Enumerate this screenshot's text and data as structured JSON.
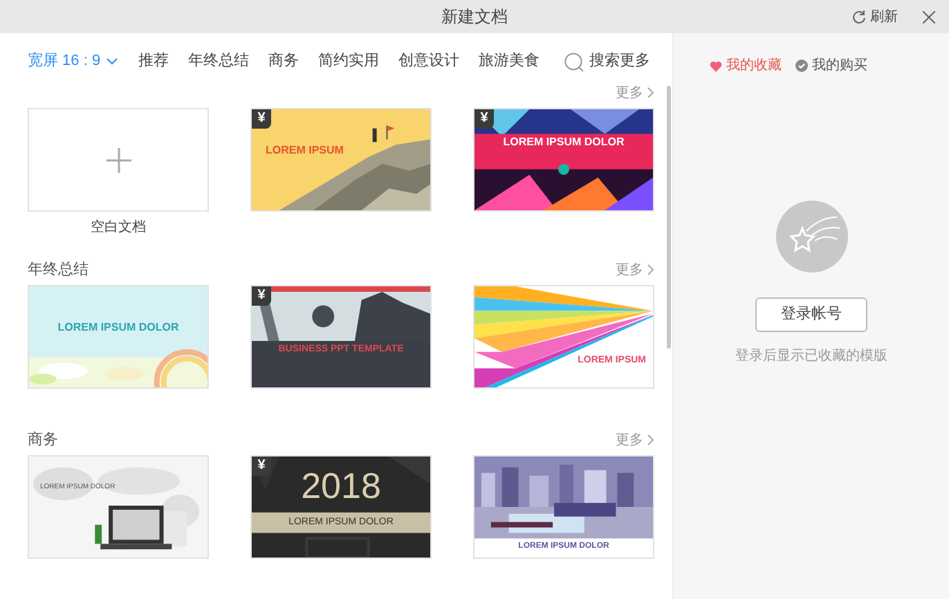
{
  "window": {
    "title": "新建文档",
    "refresh": "刷新"
  },
  "nav": {
    "ratio": "宽屏 16 : 9",
    "categories": [
      {
        "label": "推荐"
      },
      {
        "label": "年终总结"
      },
      {
        "label": "商务"
      },
      {
        "label": "简约实用"
      },
      {
        "label": "创意设计"
      },
      {
        "label": "旅游美食"
      }
    ],
    "search": "搜索更多"
  },
  "sections": [
    {
      "more": "更多",
      "cards": [
        {
          "kind": "blank",
          "caption": "空白文档"
        },
        {
          "kind": "cliff",
          "badge": "¥",
          "title": "LOREM IPSUM"
        },
        {
          "kind": "redband",
          "badge": "¥",
          "title": "LOREM IPSUM DOLOR"
        }
      ]
    },
    {
      "heading": "年终总结",
      "more": "更多",
      "cards": [
        {
          "kind": "sky",
          "title": "LOREM IPSUM DOLOR"
        },
        {
          "kind": "business",
          "badge": "¥",
          "title": "BUSINESS PPT TEMPLATE"
        },
        {
          "kind": "rainbow",
          "title": "LOREM IPSUM"
        }
      ]
    },
    {
      "heading": "商务",
      "more": "更多",
      "cards": [
        {
          "kind": "map",
          "title": "LOREM IPSUM DOLOR"
        },
        {
          "kind": "dark",
          "badge": "¥",
          "year": "2018",
          "title": "LOREM IPSUM DOLOR"
        },
        {
          "kind": "city",
          "title": "LOREM IPSUM DOLOR"
        }
      ]
    }
  ],
  "side": {
    "tabs": [
      {
        "label": "我的收藏",
        "selected": true
      },
      {
        "label": "我的购买",
        "selected": false
      }
    ],
    "login_button": "登录帐号",
    "hint": "登录后显示已收藏的模版"
  }
}
